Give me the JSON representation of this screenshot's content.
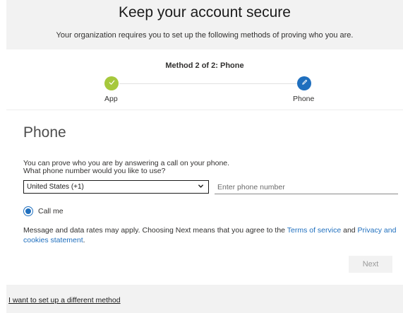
{
  "header": {
    "title": "Keep your account secure",
    "subtitle": "Your organization requires you to set up the following methods of proving who you are."
  },
  "wizard": {
    "step_label": "Method 2 of 2: Phone",
    "steps": [
      {
        "label": "App",
        "state": "completed",
        "icon": "check-icon",
        "color": "#a6c83c"
      },
      {
        "label": "Phone",
        "state": "current",
        "icon": "pencil-icon",
        "color": "#1f6fbe"
      }
    ]
  },
  "phone_section": {
    "heading": "Phone",
    "description_line1": "You can prove who you are by answering a call on your phone.",
    "description_line2": "What phone number would you like to use?",
    "country_select": {
      "selected": "United States (+1)"
    },
    "phone_input": {
      "placeholder": "Enter phone number",
      "value": ""
    },
    "radio": {
      "label": "Call me",
      "checked": true
    },
    "terms": {
      "prefix": "Message and data rates may apply. Choosing Next means that you agree to the ",
      "link1": "Terms of service",
      "middle": " and ",
      "link2": "Privacy and cookies statement",
      "suffix": "."
    },
    "next_label": "Next"
  },
  "footer": {
    "link_label": "I want to set up a different method"
  },
  "colors": {
    "accent": "#1f6fbe",
    "completed": "#a6c83c",
    "background": "#f2f2f2"
  }
}
